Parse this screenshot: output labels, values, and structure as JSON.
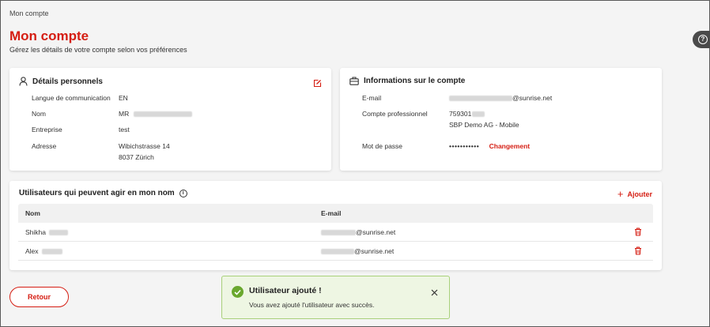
{
  "breadcrumb": "Mon compte",
  "page": {
    "title": "Mon compte",
    "subtitle": "Gérez les détails de votre compte selon vos préférences"
  },
  "personal": {
    "title": "Détails personnels",
    "rows": [
      {
        "label": "Langue de communication",
        "value": "EN"
      },
      {
        "label": "Nom",
        "value": "MR"
      },
      {
        "label": "Entreprise",
        "value": "test"
      },
      {
        "label": "Adresse",
        "value": "Wibichstrasse 14",
        "value2": "8037 Zürich"
      }
    ]
  },
  "account": {
    "title": "Informations sur le compte",
    "email_label": "E-mail",
    "email_domain": "@sunrise.net",
    "business_label": "Compte professionnel",
    "business_number": "759301",
    "business_name": "SBP Demo AG - Mobile",
    "password_label": "Mot de passe",
    "password_dots": "•••••••••••",
    "change_label": "Changement"
  },
  "users": {
    "title": "Utilisateurs qui peuvent agir en mon nom",
    "add_label": "Ajouter",
    "columns": [
      "Nom",
      "E-mail"
    ],
    "rows": [
      {
        "name": "Shikha",
        "email_domain": "@sunrise.net"
      },
      {
        "name": "Alex",
        "email_domain": "@sunrise.net"
      }
    ]
  },
  "back_label": "Retour",
  "toast": {
    "title": "Utilisateur ajouté !",
    "message": "Vous avez ajouté l'utilisateur avec succès."
  },
  "colors": {
    "brand_red": "#d51d12",
    "success_green": "#6aa82e",
    "toast_bg": "#eef6e3"
  },
  "icons": [
    "user-icon",
    "edit-icon",
    "briefcase-icon",
    "info-icon",
    "plus-icon",
    "trash-icon",
    "check-icon",
    "close-icon",
    "help-icon"
  ]
}
